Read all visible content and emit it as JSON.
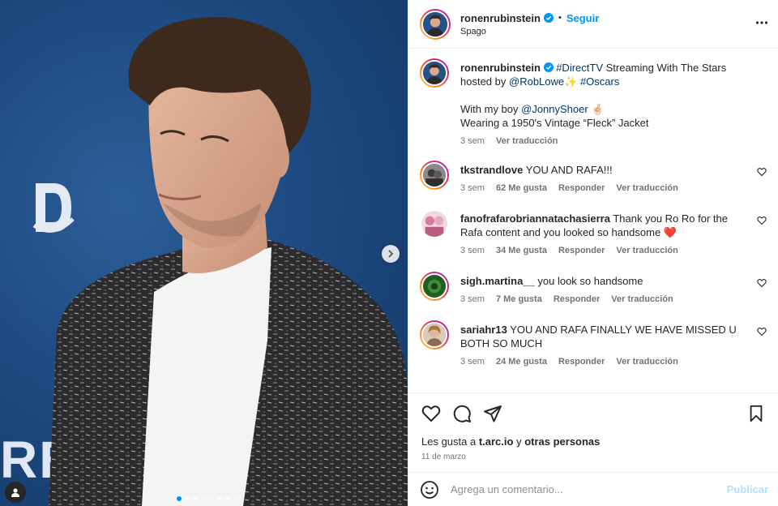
{
  "post": {
    "username": "ronenrubinstein",
    "follow_label": "Seguir",
    "location": "Spago",
    "separator": "•"
  },
  "caption": {
    "username": "ronenrubinstein",
    "line1_a": "#DirectTV",
    "line1_b": " Streaming With The Stars hosted by ",
    "line1_c": "@RobLowe",
    "line1_d": "✨ ",
    "line1_e": "#Oscars",
    "line2_a": "With my boy ",
    "line2_b": "@JonnyShoer",
    "line2_c": " 🤞🏻",
    "line3": "Wearing a 1950's Vintage “Fleck” Jacket",
    "time": "3 sem",
    "translate": "Ver traducción"
  },
  "comments": [
    {
      "username": "tkstrandlove",
      "text": "YOU AND RAFA!!!",
      "time": "3 sem",
      "likes": "62 Me gusta",
      "reply": "Responder",
      "translate": "Ver traducción"
    },
    {
      "username": "fanofrafarobriannatachasierra",
      "text": "Thank you Ro Ro for the Rafa content and you looked so handsome ❤️",
      "time": "3 sem",
      "likes": "34 Me gusta",
      "reply": "Responder",
      "translate": "Ver traducción"
    },
    {
      "username": "sigh.martina__",
      "text": "you look so handsome",
      "time": "3 sem",
      "likes": "7 Me gusta",
      "reply": "Responder",
      "translate": "Ver traducción"
    },
    {
      "username": "sariahr13",
      "text": "YOU AND RAFA FINALLY WE HAVE MISSED U BOTH SO MUCH",
      "time": "3 sem",
      "likes": "24 Me gusta",
      "reply": "Responder",
      "translate": "Ver traducción"
    }
  ],
  "likes": {
    "prefix": "Les gusta a ",
    "user": "t.arc.io",
    "middle": " y ",
    "others": "otras personas"
  },
  "date": "11 de marzo",
  "add_comment": {
    "placeholder": "Agrega un comentario...",
    "publish_label": "Publicar"
  },
  "carousel": {
    "current": 1,
    "total": 8
  },
  "photo": {
    "backdrop_letters": "RE"
  },
  "icons": {
    "verified": "verified-badge-icon",
    "more": "more-options-icon",
    "like": "heart-icon",
    "comment": "comment-icon",
    "share": "send-icon",
    "save": "bookmark-icon",
    "emoji": "emoji-icon",
    "next": "chevron-right-icon",
    "tags": "user-tag-icon"
  },
  "colors": {
    "accent": "#0095f6",
    "link": "#00376b",
    "muted": "#737373",
    "publish_disabled": "#b2dffc",
    "backdrop": "#1d4a80"
  }
}
